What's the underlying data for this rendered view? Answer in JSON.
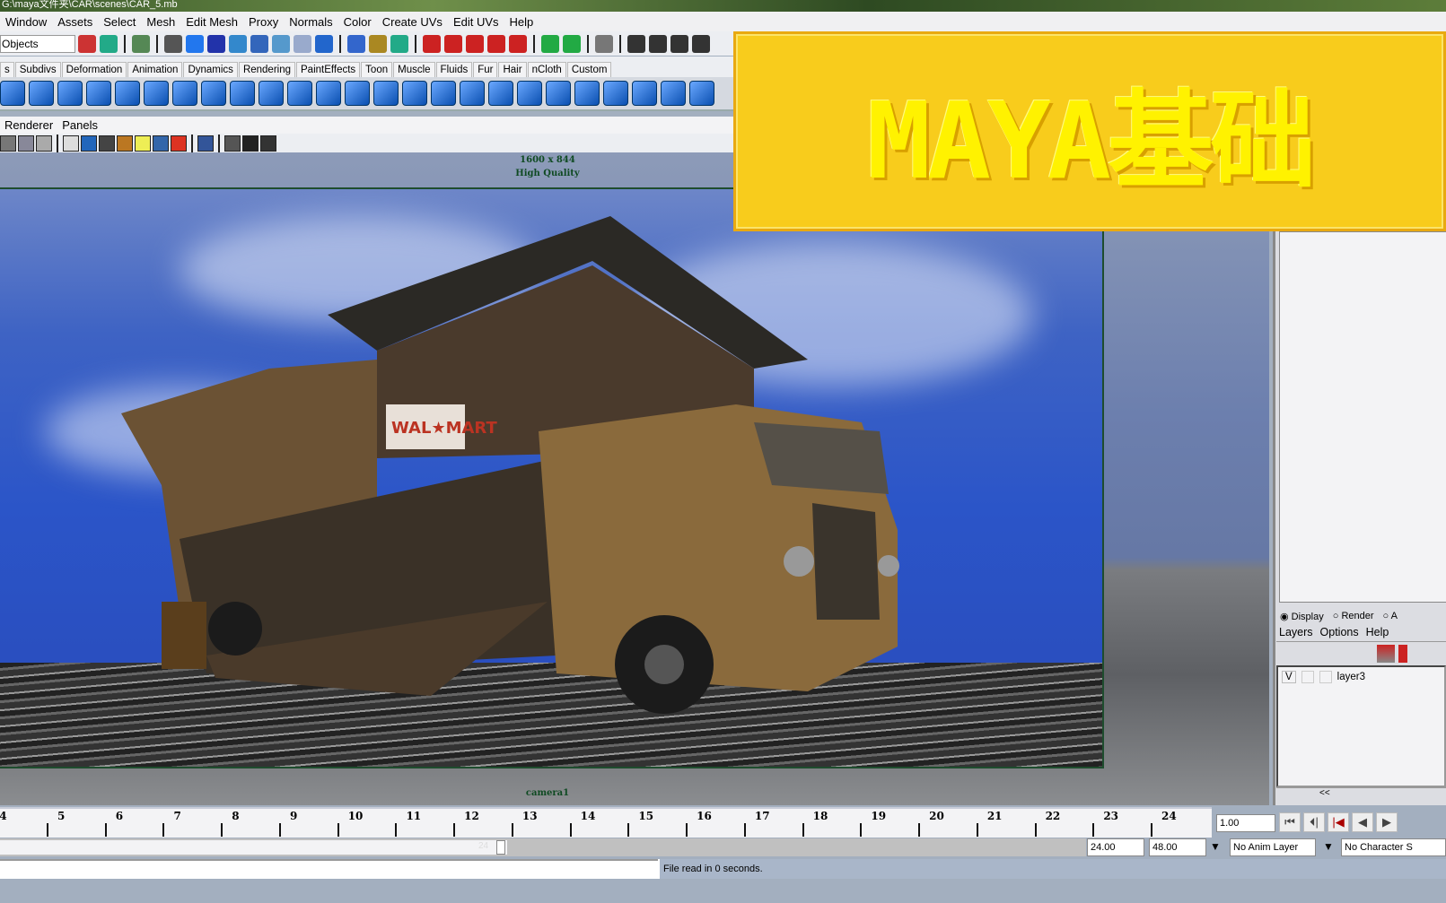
{
  "title": "G:\\maya文件夹\\CAR\\scenes\\CAR_5.mb",
  "menu": [
    "Window",
    "Assets",
    "Select",
    "Mesh",
    "Edit Mesh",
    "Proxy",
    "Normals",
    "Color",
    "Create UVs",
    "Edit UVs",
    "Help"
  ],
  "statusline": {
    "selection_mode": "Objects"
  },
  "shelf_tabs": [
    "s",
    "Subdivs",
    "Deformation",
    "Animation",
    "Dynamics",
    "Rendering",
    "PaintEffects",
    "Toon",
    "Muscle",
    "Fluids",
    "Fur",
    "Hair",
    "nCloth",
    "Custom"
  ],
  "panel_menu": [
    "Renderer",
    "Panels"
  ],
  "viewport": {
    "resolution": "1600 x 844",
    "quality": "High Quality",
    "camera": "camera1"
  },
  "banner": {
    "text": "MAYA基础"
  },
  "layer_editor": {
    "modes": [
      "Display",
      "Render",
      "A"
    ],
    "menu": [
      "Layers",
      "Options",
      "Help"
    ],
    "layers": [
      {
        "visible": "V",
        "name": "layer3"
      }
    ],
    "collapse": "<<"
  },
  "timeline": {
    "ticks": [
      4,
      5,
      6,
      7,
      8,
      9,
      10,
      11,
      12,
      13,
      14,
      15,
      16,
      17,
      18,
      19,
      20,
      21,
      22,
      23,
      24
    ],
    "current_frame": "1.00"
  },
  "range": {
    "handle": "24",
    "end": "24.00",
    "max": "48.00",
    "anim_layer": "No Anim Layer",
    "character_set": "No Character S"
  },
  "feedback": "File read in 0 seconds.",
  "colors": {
    "banner": "#f8cc1c",
    "banner_text": "#fff200",
    "hud": "#0f4a22"
  }
}
